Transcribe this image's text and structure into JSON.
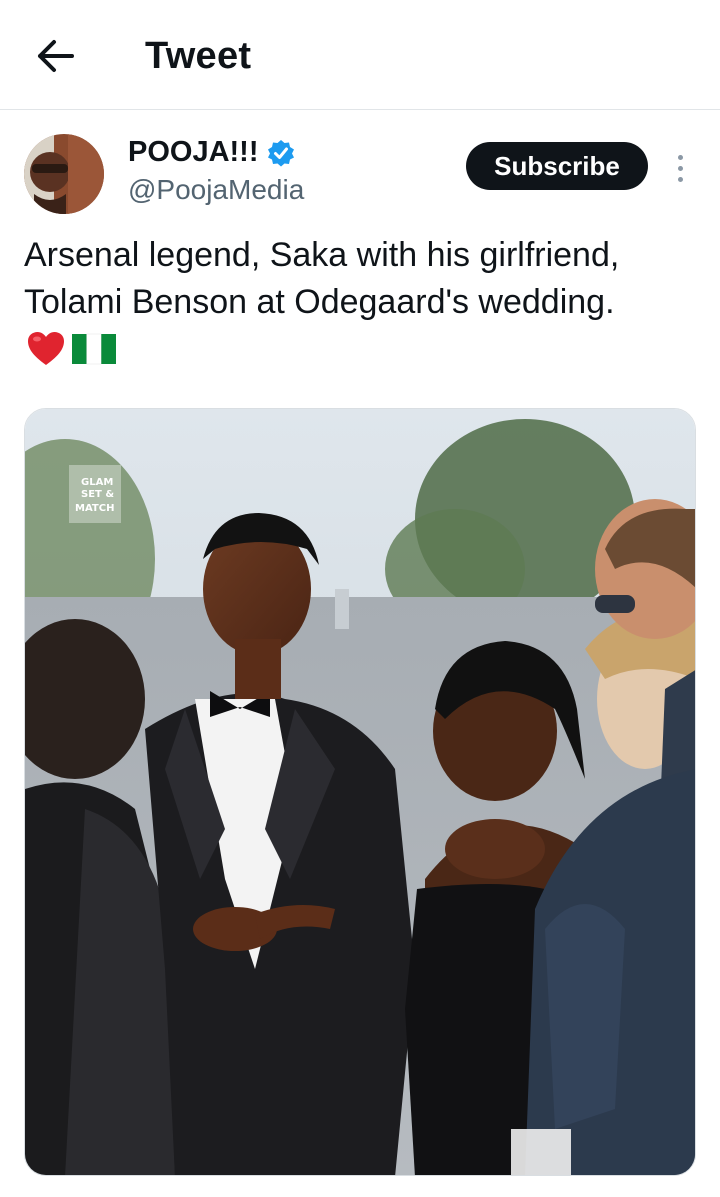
{
  "header": {
    "title": "Tweet"
  },
  "author": {
    "name": "POOJA!!!",
    "handle": "@PoojaMedia",
    "verified": true
  },
  "actions": {
    "subscribe_label": "Subscribe"
  },
  "tweet": {
    "lines": [
      "Arsenal legend, Saka with his girlfriend,",
      "Tolami Benson at Odegaard's wedding."
    ],
    "emojis": [
      "red-heart-emoji",
      "nigeria-flag-emoji"
    ]
  },
  "media": {
    "watermark": {
      "line1": "GLAM",
      "line2": "SET &",
      "line3": "MATCH"
    }
  },
  "colors": {
    "accent": "#1d9bf0",
    "text": "#0f1419",
    "muted": "#536471",
    "button": "#0f1419"
  }
}
